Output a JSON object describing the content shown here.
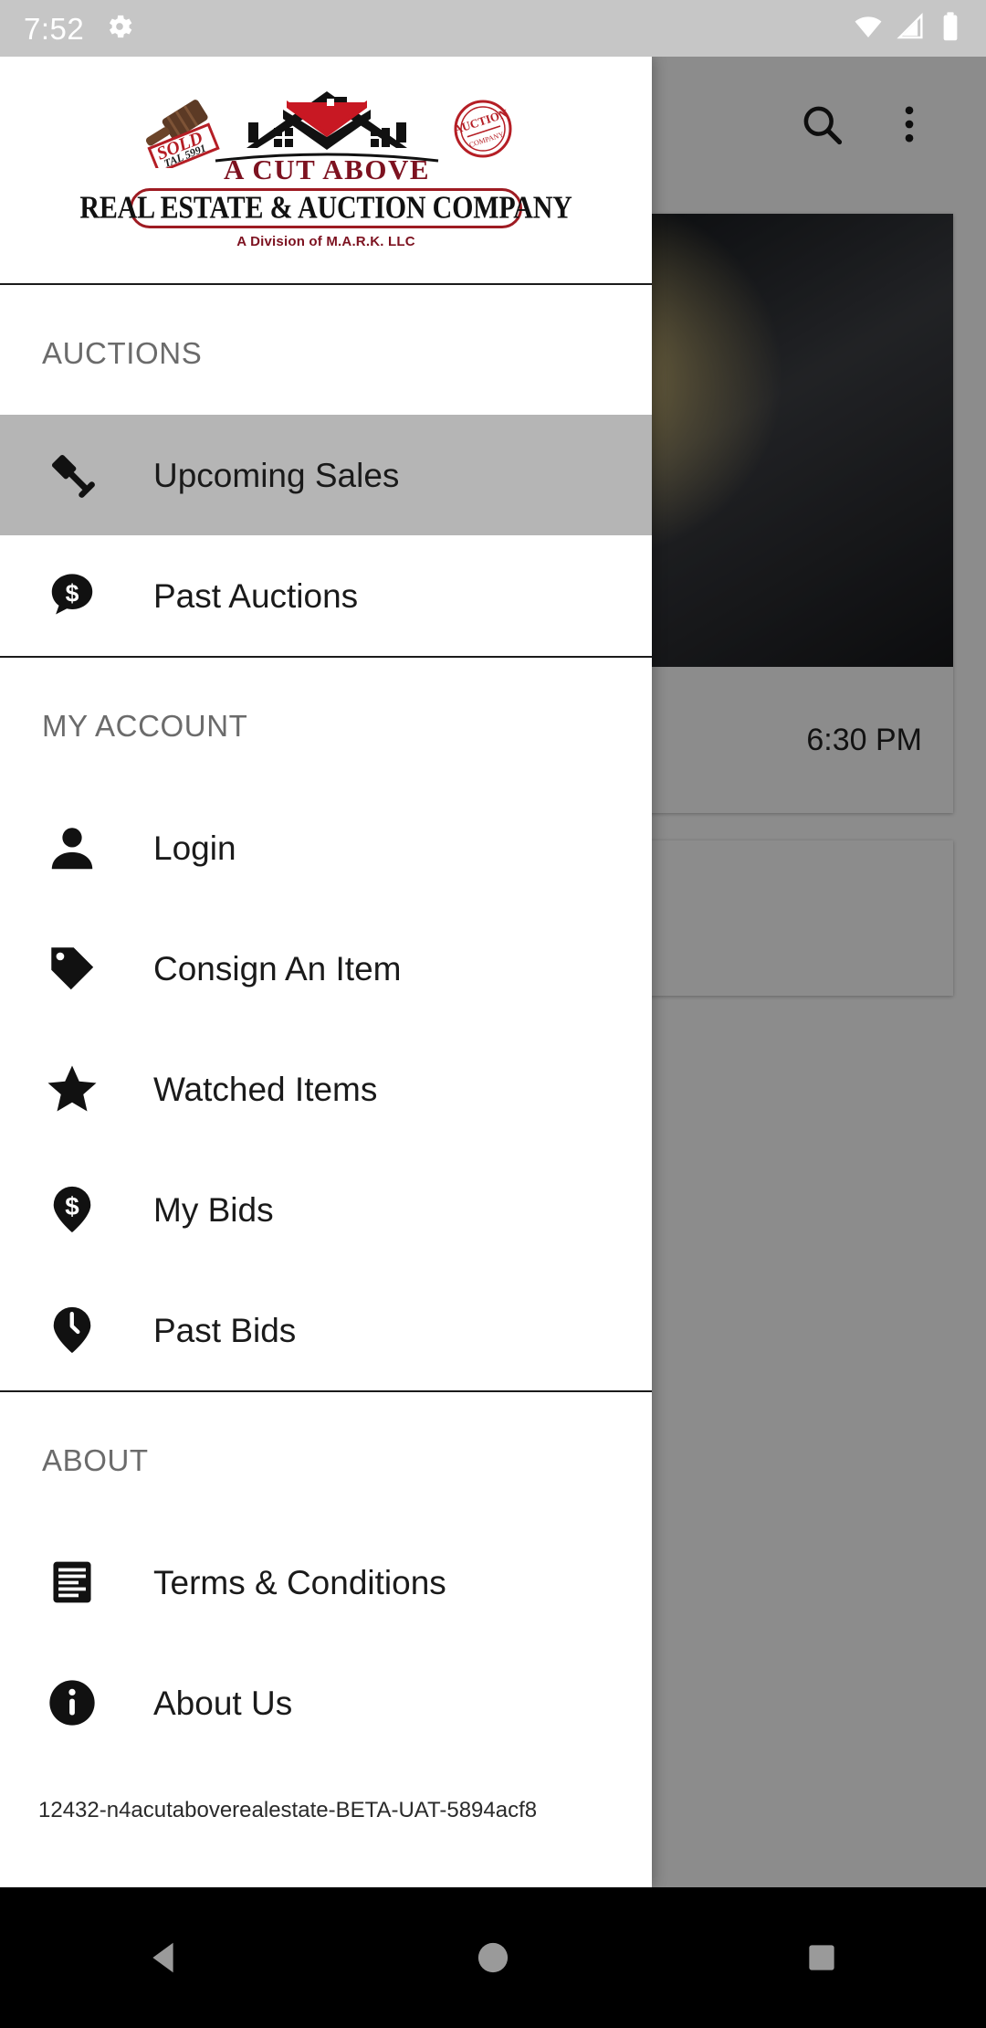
{
  "status_bar": {
    "time": "7:52",
    "icons": [
      "settings-gear-icon",
      "wifi-icon",
      "cell-signal-icon",
      "battery-icon"
    ]
  },
  "app": {
    "toolbar": {
      "search_icon": "search-icon",
      "overflow_icon": "more-vert-icon"
    },
    "card": {
      "time_label": "6:30 PM"
    }
  },
  "drawer": {
    "logo": {
      "gavel_stamp_line1": "SOLD",
      "gavel_stamp_line2": "TAL 5991",
      "seal_text": "AUCTION",
      "title": "A CUT ABOVE",
      "banner": "REAL ESTATE & AUCTION COMPANY",
      "division": "A Division of M.A.R.K. LLC",
      "accent_red": "#9e1b22",
      "accent_dark_red": "#7d1220"
    },
    "sections": [
      {
        "title": "AUCTIONS",
        "items": [
          {
            "label": "Upcoming Sales",
            "icon": "gavel-icon",
            "selected": true
          },
          {
            "label": "Past Auctions",
            "icon": "dollar-chat-bubble-icon",
            "selected": false
          }
        ]
      },
      {
        "title": "MY ACCOUNT",
        "items": [
          {
            "label": "Login",
            "icon": "person-icon",
            "selected": false
          },
          {
            "label": "Consign An Item",
            "icon": "tag-icon",
            "selected": false
          },
          {
            "label": "Watched Items",
            "icon": "star-icon",
            "selected": false
          },
          {
            "label": "My Bids",
            "icon": "dollar-pin-icon",
            "selected": false
          },
          {
            "label": "Past Bids",
            "icon": "clock-pin-icon",
            "selected": false
          }
        ]
      },
      {
        "title": "ABOUT",
        "items": [
          {
            "label": "Terms & Conditions",
            "icon": "document-lines-icon",
            "selected": false
          },
          {
            "label": "About Us",
            "icon": "info-circle-icon",
            "selected": false
          }
        ]
      }
    ],
    "footer_version": "12432-n4acutaboverealestate-BETA-UAT-5894acf8"
  },
  "nav_bar": {
    "back": "back-triangle-icon",
    "home": "home-circle-icon",
    "recents": "recents-square-icon"
  }
}
